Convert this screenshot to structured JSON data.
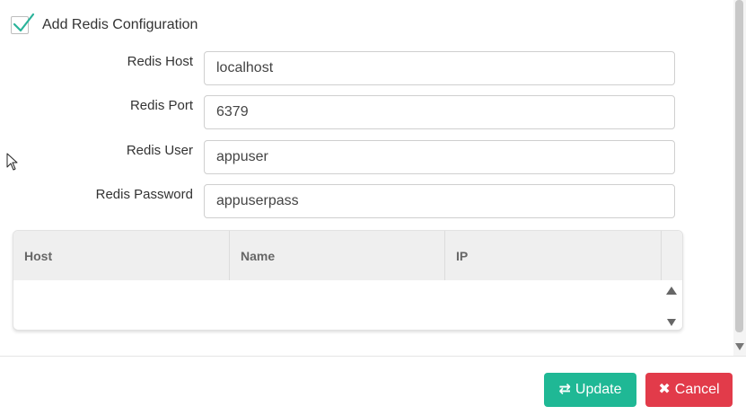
{
  "redis_config": {
    "checkbox_label": "Add Redis Configuration",
    "checked": true,
    "fields": [
      {
        "label": "Redis Host",
        "value": "localhost"
      },
      {
        "label": "Redis Port",
        "value": "6379"
      },
      {
        "label": "Redis User",
        "value": "appuser"
      },
      {
        "label": "Redis Password",
        "value": "appuserpass"
      }
    ]
  },
  "table": {
    "columns": [
      "Host",
      "Name",
      "IP"
    ],
    "rows": []
  },
  "footer": {
    "update_label": "Update",
    "update_icon": "exchange-icon",
    "cancel_label": "Cancel",
    "cancel_icon": "close-icon"
  },
  "colors": {
    "check_accent": "#2ab39a",
    "update_button": "#1fb895",
    "cancel_button": "#e23b4a"
  }
}
